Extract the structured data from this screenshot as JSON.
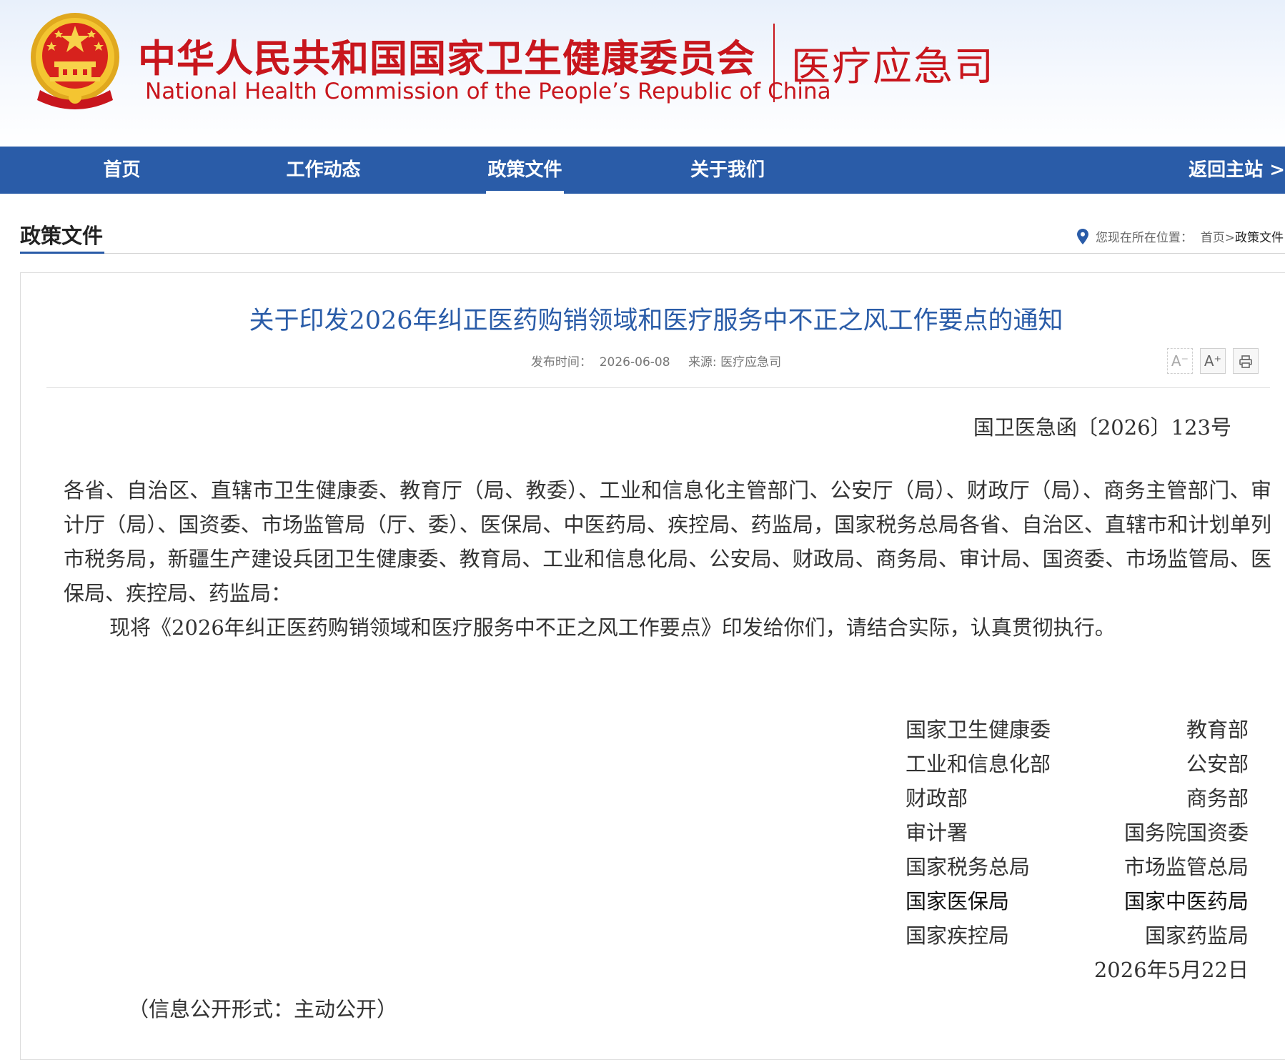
{
  "header": {
    "org_name_cn": "中华人民共和国国家卫生健康委员会",
    "org_name_en": "National Health Commission of the People’s  Republic of China",
    "dept_name": "医疗应急司"
  },
  "nav": {
    "items": [
      "首页",
      "工作动态",
      "政策文件",
      "关于我们"
    ],
    "active": "政策文件",
    "back": "返回主站 >"
  },
  "section": {
    "title": "政策文件",
    "breadcrumb_prefix": "您现在所在位置：",
    "breadcrumb_home": "首页",
    "breadcrumb_sep": ">",
    "breadcrumb_current": "政策文件"
  },
  "article": {
    "title": "关于印发2026年纠正医药购销领域和医疗服务中不正之风工作要点的通知",
    "publish_label": "发布时间：",
    "publish_date": "2026-06-08",
    "source_label": "来源:",
    "source": "医疗应急司",
    "tools": {
      "font_smaller": "A⁻",
      "font_larger": "A⁺"
    },
    "doc_number": "国卫医急函〔2026〕123号",
    "addressees": "各省、自治区、直辖市卫生健康委、教育厅（局、教委）、工业和信息化主管部门、公安厅（局）、财政厅（局）、商务主管部门、审计厅（局）、国资委、市场监管局（厅、委）、医保局、中医药局、疾控局、药监局，国家税务总局各省、自治区、直辖市和计划单列市税务局，新疆生产建设兵团卫生健康委、教育局、工业和信息化局、公安局、财政局、商务局、审计局、国资委、市场监管局、医保局、疾控局、药监局：",
    "body": "现将《2026年纠正医药购销领域和医疗服务中不正之风工作要点》印发给你们，请结合实际，认真贯彻执行。",
    "signatories": [
      [
        "国家卫生健康委",
        "教育部"
      ],
      [
        "工业和信息化部",
        "公安部"
      ],
      [
        "财政部",
        "商务部"
      ],
      [
        "审计署",
        "国务院国资委"
      ],
      [
        "国家税务总局",
        "市场监管总局"
      ],
      [
        "国家医保局",
        "国家中医药局"
      ],
      [
        "国家疾控局",
        "国家药监局"
      ]
    ],
    "sign_date": "2026年5月22日",
    "disclosure": "（信息公开形式：主动公开）"
  },
  "colors": {
    "brand_red": "#c8161d",
    "nav_blue": "#2a5ca8",
    "title_blue": "#2a5ca8"
  }
}
